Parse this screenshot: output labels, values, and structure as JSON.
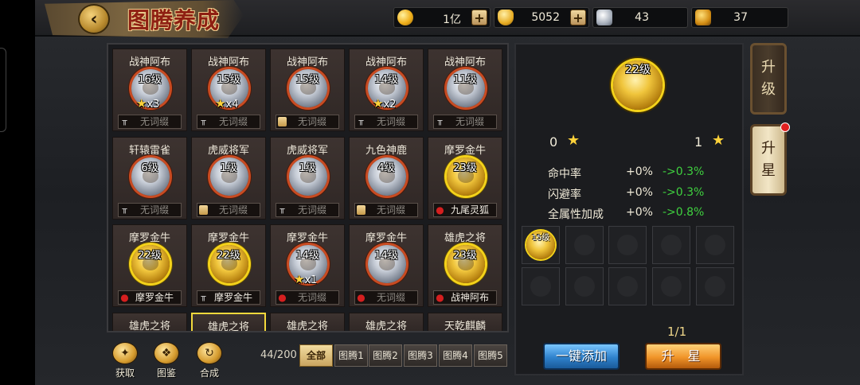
{
  "header": {
    "title": "图腾养成",
    "resources": [
      {
        "icon": "gold-coin-icon",
        "value": "1亿",
        "has_plus": true
      },
      {
        "icon": "gold-ingot-icon",
        "value": "5052",
        "has_plus": true
      },
      {
        "icon": "silver-beast-icon",
        "value": "43",
        "has_plus": false
      },
      {
        "icon": "gold-beast-icon",
        "value": "37",
        "has_plus": false
      }
    ]
  },
  "cards": [
    {
      "name": "战神阿布",
      "level": "16级",
      "type": "silver",
      "stars": "x3",
      "slot_icon": "pillar",
      "slot": "无词缀",
      "slot_filled": false
    },
    {
      "name": "战神阿布",
      "level": "15级",
      "type": "silver",
      "stars": "x4",
      "slot_icon": "pillar",
      "slot": "无词缀",
      "slot_filled": false
    },
    {
      "name": "战神阿布",
      "level": "15级",
      "type": "silver",
      "stars": "",
      "slot_icon": "scroll",
      "slot": "无词缀",
      "slot_filled": false
    },
    {
      "name": "战神阿布",
      "level": "14级",
      "type": "silver",
      "stars": "x2",
      "slot_icon": "pillar",
      "slot": "无词缀",
      "slot_filled": false
    },
    {
      "name": "战神阿布",
      "level": "11级",
      "type": "silver",
      "stars": "",
      "slot_icon": "pillar",
      "slot": "无词缀",
      "slot_filled": false
    },
    {
      "name": "轩辕雷雀",
      "level": "6级",
      "type": "silver",
      "stars": "",
      "slot_icon": "pillar",
      "slot": "无词缀",
      "slot_filled": false
    },
    {
      "name": "虎威将军",
      "level": "1级",
      "type": "silver",
      "stars": "",
      "slot_icon": "scroll",
      "slot": "无词缀",
      "slot_filled": false
    },
    {
      "name": "虎威将军",
      "level": "1级",
      "type": "silver",
      "stars": "",
      "slot_icon": "pillar",
      "slot": "无词缀",
      "slot_filled": false
    },
    {
      "name": "九色神鹿",
      "level": "4级",
      "type": "silver",
      "stars": "",
      "slot_icon": "scroll",
      "slot": "无词缀",
      "slot_filled": false
    },
    {
      "name": "摩罗金牛",
      "level": "23级",
      "type": "gold",
      "stars": "",
      "slot_icon": "drop",
      "slot": "九尾灵狐",
      "slot_filled": true
    },
    {
      "name": "摩罗金牛",
      "level": "22级",
      "type": "gold",
      "stars": "",
      "slot_icon": "drop",
      "slot": "摩罗金牛",
      "slot_filled": true
    },
    {
      "name": "摩罗金牛",
      "level": "22级",
      "type": "gold",
      "stars": "",
      "slot_icon": "pillar",
      "slot": "摩罗金牛",
      "slot_filled": true
    },
    {
      "name": "摩罗金牛",
      "level": "14级",
      "type": "silver",
      "stars": "x1",
      "slot_icon": "drop",
      "slot": "无词缀",
      "slot_filled": false
    },
    {
      "name": "摩罗金牛",
      "level": "14级",
      "type": "silver",
      "stars": "",
      "slot_icon": "drop",
      "slot": "无词缀",
      "slot_filled": false
    },
    {
      "name": "雄虎之将",
      "level": "23级",
      "type": "gold",
      "stars": "",
      "slot_icon": "drop",
      "slot": "战神阿布",
      "slot_filled": true
    },
    {
      "name": "雄虎之将"
    },
    {
      "name": "雄虎之将",
      "selected": true
    },
    {
      "name": "雄虎之将"
    },
    {
      "name": "雄虎之将"
    },
    {
      "name": "天乾麒麟"
    }
  ],
  "bottom": {
    "actions": [
      {
        "icon": "obtain-icon",
        "label": "获取"
      },
      {
        "icon": "catalog-icon",
        "label": "图鉴"
      },
      {
        "icon": "synthesize-icon",
        "label": "合成"
      }
    ],
    "count": "44/200",
    "tabs": [
      "全部",
      "图腾1",
      "图腾2",
      "图腾3",
      "图腾4",
      "图腾5"
    ],
    "active_tab": 0
  },
  "detail": {
    "level": "22级",
    "star_current": "0",
    "star_next": "1",
    "attrs": [
      {
        "name": "命中率",
        "current": "+0%",
        "next": "->0.3%"
      },
      {
        "name": "闪避率",
        "current": "+0%",
        "next": "->0.3%"
      },
      {
        "name": "全属性加成",
        "current": "+0%",
        "next": "->0.8%"
      }
    ],
    "material_slots": [
      {
        "filled": true,
        "level": "15级"
      },
      {},
      {},
      {},
      {},
      {},
      {},
      {},
      {},
      {}
    ],
    "page": "1/1",
    "add_all_label": "一键添加",
    "star_up_label": "升 星"
  },
  "side_tabs": [
    {
      "label": "升\n级",
      "active": false
    },
    {
      "label": "升\n星",
      "active": true,
      "badge": true
    }
  ],
  "colors": {
    "accent_gold": "#f4d21a",
    "positive_green": "#3fd13f",
    "title_red": "#8e1f12"
  }
}
